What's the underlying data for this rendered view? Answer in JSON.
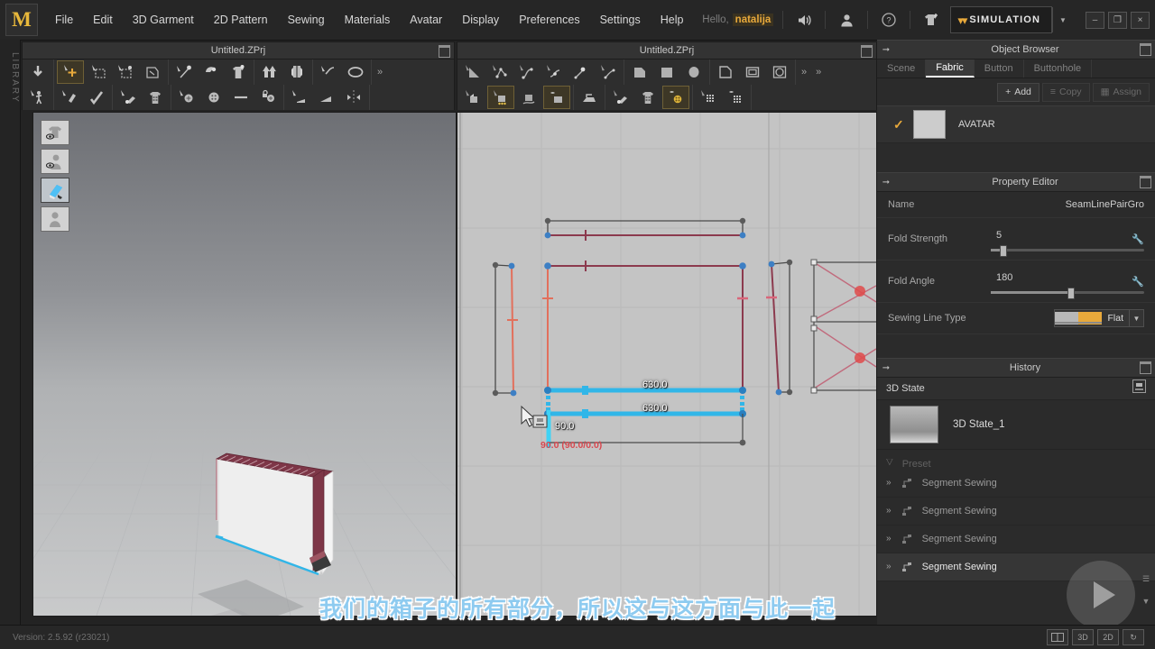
{
  "app": {
    "logo_text": "M",
    "version": "Version: 2.5.92      (r23021)"
  },
  "menubar": {
    "items": [
      {
        "label": "File"
      },
      {
        "label": "Edit"
      },
      {
        "label": "3D Garment"
      },
      {
        "label": "2D Pattern"
      },
      {
        "label": "Sewing"
      },
      {
        "label": "Materials"
      },
      {
        "label": "Avatar"
      },
      {
        "label": "Display"
      },
      {
        "label": "Preferences"
      },
      {
        "label": "Settings"
      },
      {
        "label": "Help"
      }
    ],
    "greeting": "Hello,",
    "username": "natalija",
    "simulation_label": "SIMULATION",
    "window_minimize": "–",
    "window_restore": "❐",
    "window_close": "×"
  },
  "library_tab": {
    "label": "LIBRARY"
  },
  "view3d": {
    "title": "Untitled.ZPrj",
    "overlay_buttons": [
      "show-garment-toggle",
      "show-avatar-toggle",
      "show-texture-toggle",
      "avatar-pose-toggle"
    ]
  },
  "view2d": {
    "title": "Untitled.ZPrj",
    "measurements": [
      {
        "label": "630.0",
        "kind": "segment-length-top"
      },
      {
        "label": "630.0",
        "kind": "segment-length-bottom"
      },
      {
        "label": "90.0",
        "kind": "segment-length-vertical"
      },
      {
        "label": "90.0 (90.0/0.0)",
        "kind": "angle-readout"
      }
    ]
  },
  "object_browser": {
    "title": "Object Browser",
    "tabs": [
      {
        "label": "Scene",
        "active": false
      },
      {
        "label": "Fabric",
        "active": true
      },
      {
        "label": "Button",
        "active": false
      },
      {
        "label": "Buttonhole",
        "active": false
      }
    ],
    "actions": [
      {
        "label": "Add",
        "enabled": true
      },
      {
        "label": "Copy",
        "enabled": false
      },
      {
        "label": "Assign",
        "enabled": false
      }
    ],
    "rows": [
      {
        "name": "AVATAR",
        "checked": true
      }
    ]
  },
  "property_editor": {
    "title": "Property Editor",
    "rows": [
      {
        "label": "Name",
        "value": "SeamLinePairGro",
        "type": "text"
      },
      {
        "label": "Fold Strength",
        "value": "5",
        "type": "slider",
        "fill": 9
      },
      {
        "label": "Fold Angle",
        "value": "180",
        "type": "slider",
        "fill": 50
      },
      {
        "label": "Sewing Line Type",
        "value": "Flat",
        "type": "combo"
      }
    ]
  },
  "history": {
    "title": "History",
    "state_label": "3D State",
    "state_item": "3D State_1",
    "cut_item": "Preset",
    "items": [
      {
        "label": "Segment Sewing",
        "highlighted": false
      },
      {
        "label": "Segment Sewing",
        "highlighted": false
      },
      {
        "label": "Segment Sewing",
        "highlighted": false
      },
      {
        "label": "Segment Sewing",
        "highlighted": true
      }
    ]
  },
  "statusbar": {
    "view_buttons": [
      {
        "label": "",
        "name": "split-view-button"
      },
      {
        "label": "3D",
        "name": "view-3d-button"
      },
      {
        "label": "2D",
        "name": "view-2d-button"
      },
      {
        "label": "↻",
        "name": "reset-view-button"
      }
    ]
  },
  "subtitle": {
    "text": "我们的箱子的所有部分，所以这与这方面与此一起"
  },
  "colors": {
    "accent": "#e8a93b",
    "pattern_line": "#8c3a4e",
    "pattern_line_light": "#e2705c",
    "sewing_line": "#31b6e8",
    "vertex": "#3d7fc4",
    "angle_text": "#d8484f"
  }
}
